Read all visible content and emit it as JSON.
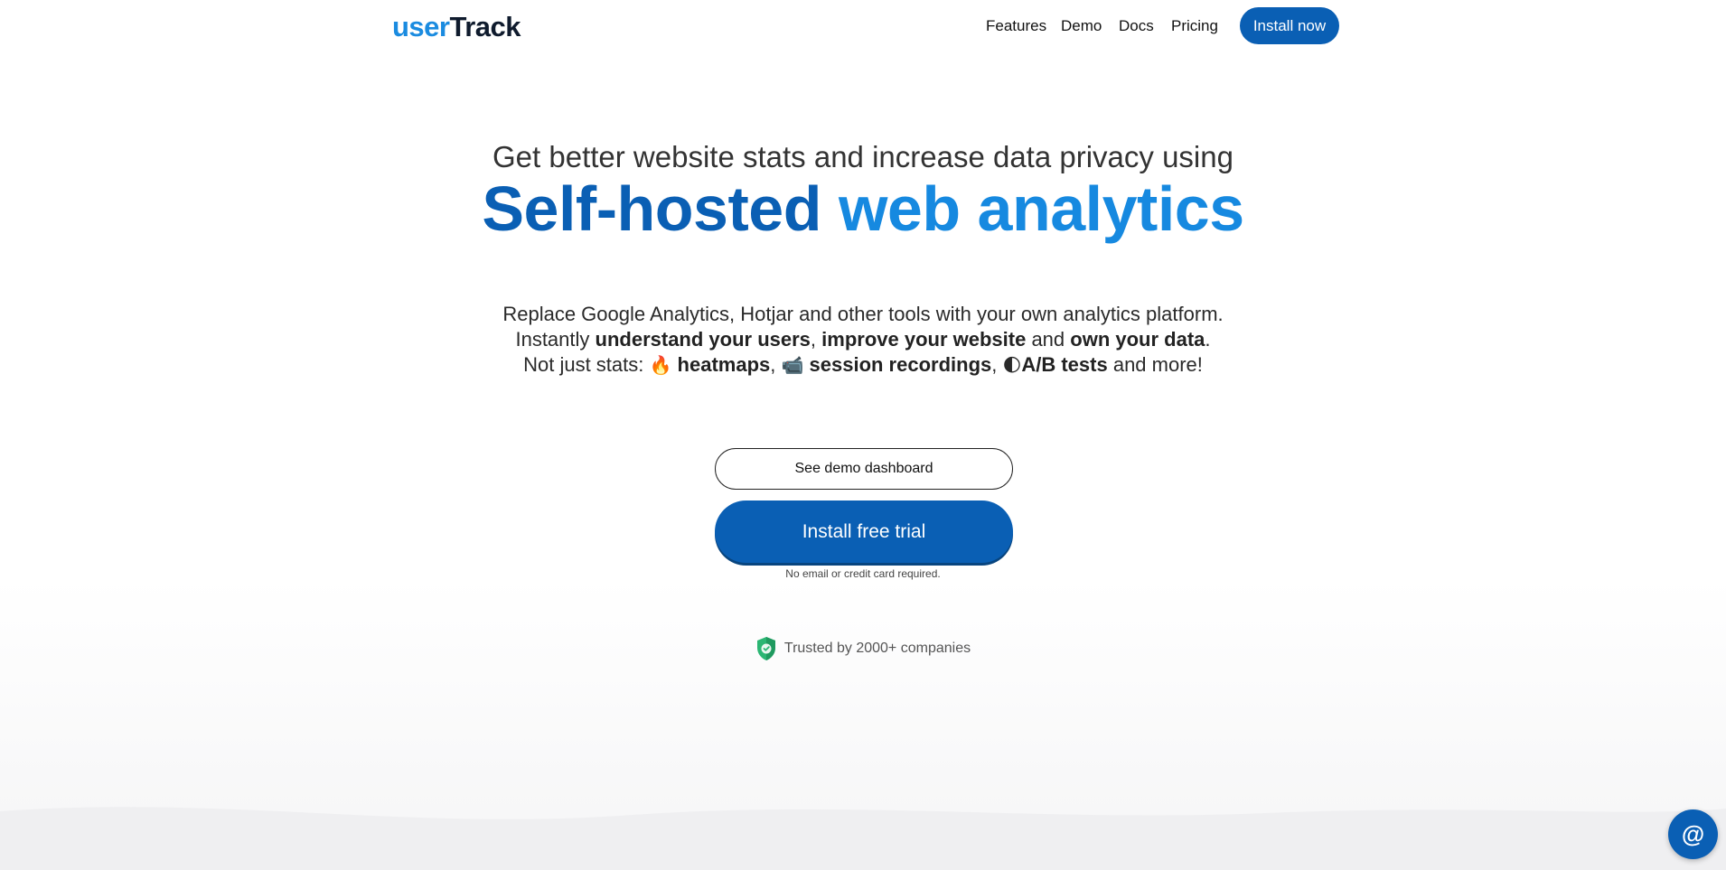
{
  "header": {
    "logo_user": "user",
    "logo_track": "Track",
    "nav": [
      "Features",
      "Demo",
      "Docs",
      "Pricing"
    ],
    "install_now": "Install now"
  },
  "hero": {
    "subhead": "Get better website stats and increase data privacy using",
    "headline_part1": "Self-hosted",
    "headline_part2": "web analytics",
    "line1": "Replace Google Analytics, Hotjar and other tools with your own analytics platform.",
    "line2_a": "Instantly ",
    "line2_b": "understand your users",
    "line2_c": ", ",
    "line2_d": "improve your website",
    "line2_e": " and ",
    "line2_f": "own your data",
    "line2_g": ".",
    "line3_a": "Not just stats: ",
    "line3_e1": "🔥",
    "line3_b": "heatmaps",
    "line3_c": ", ",
    "line3_e2": "📹",
    "line3_d": "session recordings",
    "line3_f": ", ",
    "line3_e3": "🌓",
    "line3_g": "A/B tests",
    "line3_h": " and more!"
  },
  "cta": {
    "demo": "See demo dashboard",
    "trial": "Install free trial",
    "note": "No email or credit card required."
  },
  "trust": {
    "text": "Trusted by 2000+ companies",
    "icon": "shield-check-icon"
  },
  "chat": {
    "symbol": "@"
  },
  "colors": {
    "primary": "#0a5fb4",
    "accent": "#1689e0",
    "shield": "#2bb673"
  }
}
